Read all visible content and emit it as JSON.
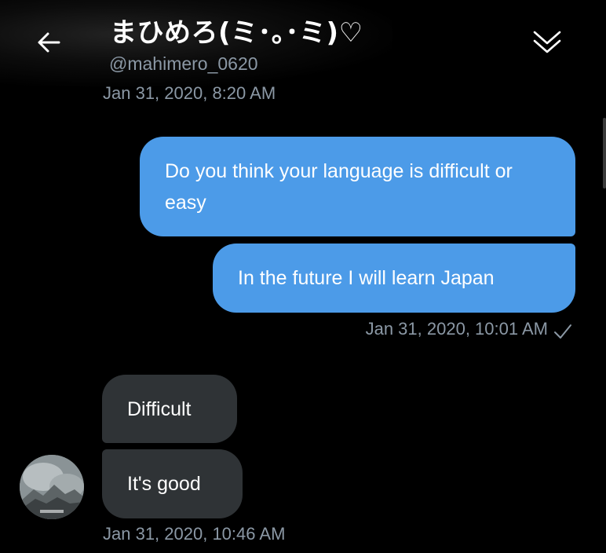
{
  "header": {
    "name": "まひめろ(ミ･｡･ミ)♡",
    "handle": "@mahimero_0620",
    "back_icon": "arrow-left-icon",
    "menu_icon": "double-chevron-down-icon"
  },
  "messages": {
    "first_timestamp": "Jan 31, 2020, 8:20 AM",
    "sent": [
      {
        "text": "Do you think your language is difficult or easy"
      },
      {
        "text": "In the future I will learn  Japan"
      }
    ],
    "sent_timestamp": "Jan 31, 2020, 10:01 AM",
    "received": [
      {
        "text": "Difficult"
      },
      {
        "text": "It's good"
      }
    ],
    "received_timestamp": "Jan 31, 2020, 10:46 AM"
  },
  "colors": {
    "background": "#000000",
    "sent_bubble": "#4c9be8",
    "received_bubble": "#2f3336",
    "secondary_text": "#8b98a5"
  }
}
